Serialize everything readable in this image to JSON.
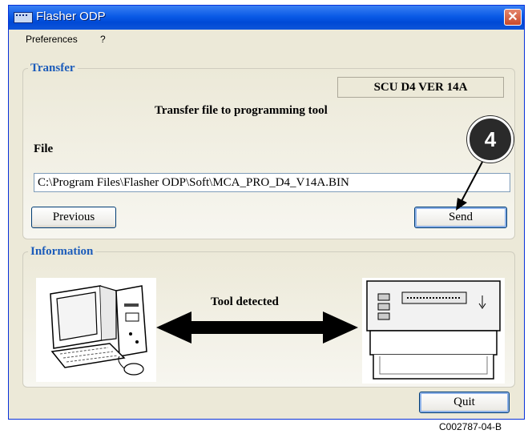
{
  "window": {
    "title": "Flasher ODP",
    "close_glyph": "✕"
  },
  "menu": {
    "items": [
      "Preferences",
      "?"
    ]
  },
  "transfer": {
    "group_label": "Transfer",
    "version_box": "SCU D4 VER  14A",
    "heading": "Transfer file to programming tool",
    "file_label": "File",
    "file_path": "C:\\Program Files\\Flasher ODP\\Soft\\MCA_PRO_D4_V14A.BIN",
    "previous_label": "Previous",
    "send_label": "Send"
  },
  "callout": {
    "number": "4"
  },
  "information": {
    "group_label": "Information",
    "status": "Tool detected",
    "icons": [
      "computer-icon",
      "bidirectional-arrow-icon",
      "programming-tool-icon"
    ]
  },
  "footer": {
    "quit_label": "Quit"
  },
  "caption": "C002787-04-B",
  "colors": {
    "title_bar": "#0a5ae6",
    "group_label": "#1c5cba",
    "window_bg": "#ece9d8",
    "close": "#c8492a"
  }
}
